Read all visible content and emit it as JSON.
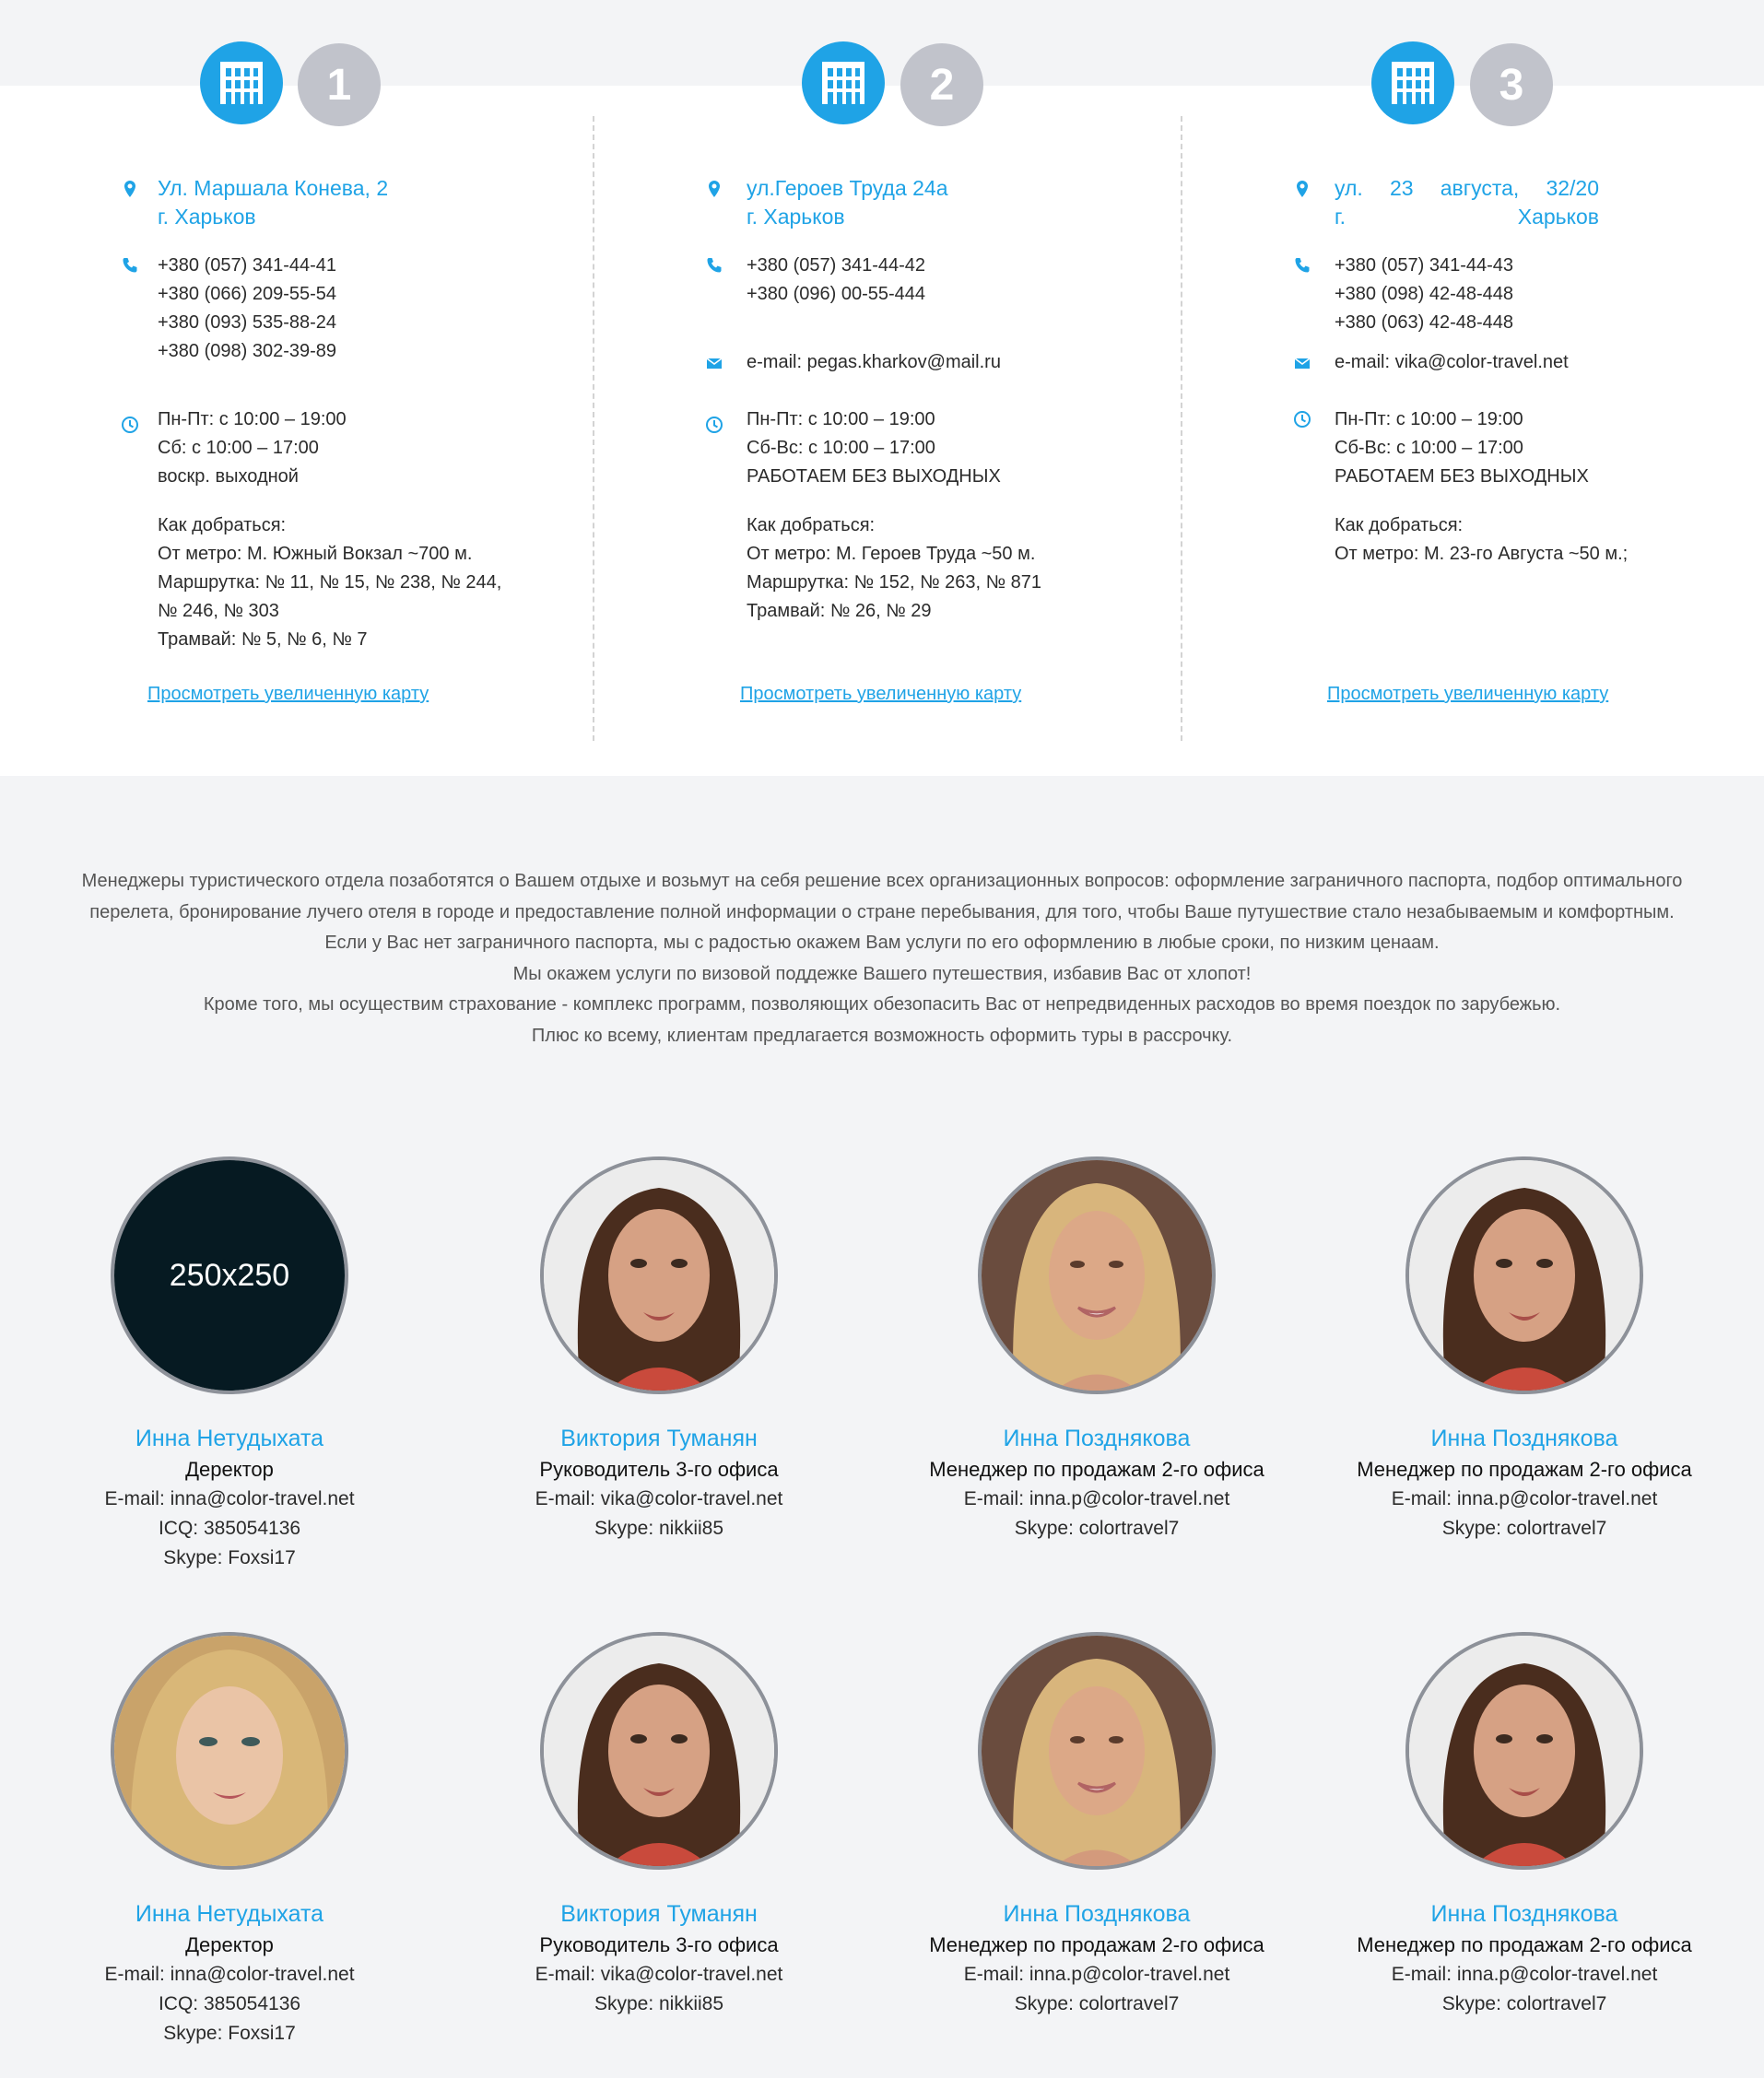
{
  "offices": [
    {
      "number": "1",
      "address": [
        "Ул. Маршала Конева, 2",
        "г. Харьков"
      ],
      "phones": [
        "+380 (057) 341-44-41",
        "+380 (066) 209-55-54",
        "+380 (093) 535-88-24",
        "+380 (098) 302-39-89"
      ],
      "email": "",
      "hours": [
        "Пн-Пт: с 10:00 – 19:00",
        "Сб: с 10:00 – 17:00",
        "воскр. выходной"
      ],
      "directions": [
        "Как добраться:",
        "От метро: М. Южный Вокзал ~700 м.",
        "Маршрутка: № 11, № 15, № 238, № 244,",
        "№ 246, № 303",
        "Трамвай: № 5, № 6, № 7"
      ],
      "map_link": "Просмотреть увеличенную карту"
    },
    {
      "number": "2",
      "address": [
        "ул.Героев Труда 24а",
        "г. Харьков"
      ],
      "phones": [
        "+380 (057) 341-44-42",
        "+380 (096) 00-55-444"
      ],
      "email": "e-mail: pegas.kharkov@mail.ru",
      "hours": [
        "Пн-Пт: с 10:00 – 19:00",
        "Сб-Вс: с 10:00 – 17:00",
        "РАБОТАЕМ БЕЗ ВЫХОДНЫХ"
      ],
      "directions": [
        "Как добраться:",
        "От метро: М. Героев Труда ~50 м.",
        "Маршрутка: № 152, № 263, № 871",
        "Трамвай: № 26, № 29"
      ],
      "map_link": "Просмотреть увеличенную карту"
    },
    {
      "number": "3",
      "address_words_line1": [
        "ул.",
        "23",
        "августа,",
        "32/20"
      ],
      "address_words_line2": [
        "г.",
        "Харьков"
      ],
      "phones": [
        "+380 (057) 341-44-43",
        "+380 (098) 42-48-448",
        "+380 (063) 42-48-448"
      ],
      "email": "e-mail: vika@color-travel.net",
      "hours": [
        "Пн-Пт: с 10:00 – 19:00",
        "Сб-Вс: с 10:00 – 17:00",
        "РАБОТАЕМ БЕЗ ВЫХОДНЫХ"
      ],
      "directions": [
        "Как добраться:",
        "От метро: М. 23-го Августа ~50 м.;"
      ],
      "map_link": "Просмотреть увеличенную карту"
    }
  ],
  "about": [
    "Менеджеры туристического отдела позаботятся о Вашем отдыхе и возьмут на себя решение всех организационных вопросов: оформление заграничного паспорта, подбор оптимального",
    "перелета, бронирование лучего отеля в городе и предоставление полной информации о стране перебывания, для того, чтобы Ваше путушествие стало незабываемым и комфортным.",
    "Если у Вас нет заграничного паспорта, мы с радостью окажем Вам услуги по его оформлению в любые сроки, по низким ценаам.",
    "Мы окажем услуги по визовой поддежке Вашего путешествия, избавив Вас от хлопот!",
    "Кроме того, мы осуществим страхование - комплекс программ, позволяющих обезопасить Вас от непредвиденных расходов во время поездок по зарубежью.",
    "Плюс ко всему, клиентам предлагается возможность оформить туры в рассрочку."
  ],
  "team": [
    {
      "placeholder": "250x250",
      "photo": "",
      "name": "Инна Нетудыхата",
      "role": "Деректор",
      "info": [
        "E-mail: inna@color-travel.net",
        "ICQ: 385054136",
        "Skype: Foxsi17"
      ]
    },
    {
      "placeholder": "",
      "photo": "brunette",
      "name": "Виктория Туманян",
      "role": "Руководитель 3-го офиса",
      "info": [
        "E-mail: vika@color-travel.net",
        "Skype: nikkii85"
      ]
    },
    {
      "placeholder": "",
      "photo": "blonde",
      "name": "Инна Позднякова",
      "role": "Менеджер по продажам 2-го офиса",
      "info": [
        "E-mail: inna.p@color-travel.net",
        "Skype: colortravel7"
      ]
    },
    {
      "placeholder": "",
      "photo": "brunette",
      "name": "Инна Позднякова",
      "role": "Менеджер по продажам 2-го офиса",
      "info": [
        "E-mail: inna.p@color-travel.net",
        "Skype: colortravel7"
      ]
    },
    {
      "placeholder": "",
      "photo": "curly-blonde",
      "name": "Инна Нетудыхата",
      "role": "Деректор",
      "info": [
        "E-mail: inna@color-travel.net",
        "ICQ: 385054136",
        "Skype: Foxsi17"
      ]
    },
    {
      "placeholder": "",
      "photo": "brunette",
      "name": "Виктория Туманян",
      "role": "Руководитель 3-го офиса",
      "info": [
        "E-mail: vika@color-travel.net",
        "Skype: nikkii85"
      ]
    },
    {
      "placeholder": "",
      "photo": "blonde",
      "name": "Инна Позднякова",
      "role": "Менеджер по продажам 2-го офиса",
      "info": [
        "E-mail: inna.p@color-travel.net",
        "Skype: colortravel7"
      ]
    },
    {
      "placeholder": "",
      "photo": "brunette",
      "name": "Инна Позднякова",
      "role": "Менеджер по продажам 2-го офиса",
      "info": [
        "E-mail: inna.p@color-travel.net",
        "Skype: colortravel7"
      ]
    }
  ],
  "colors": {
    "accent": "#1fa3e6",
    "badge_gray": "#c1c3cb",
    "avatar_border": "#8d9199"
  }
}
